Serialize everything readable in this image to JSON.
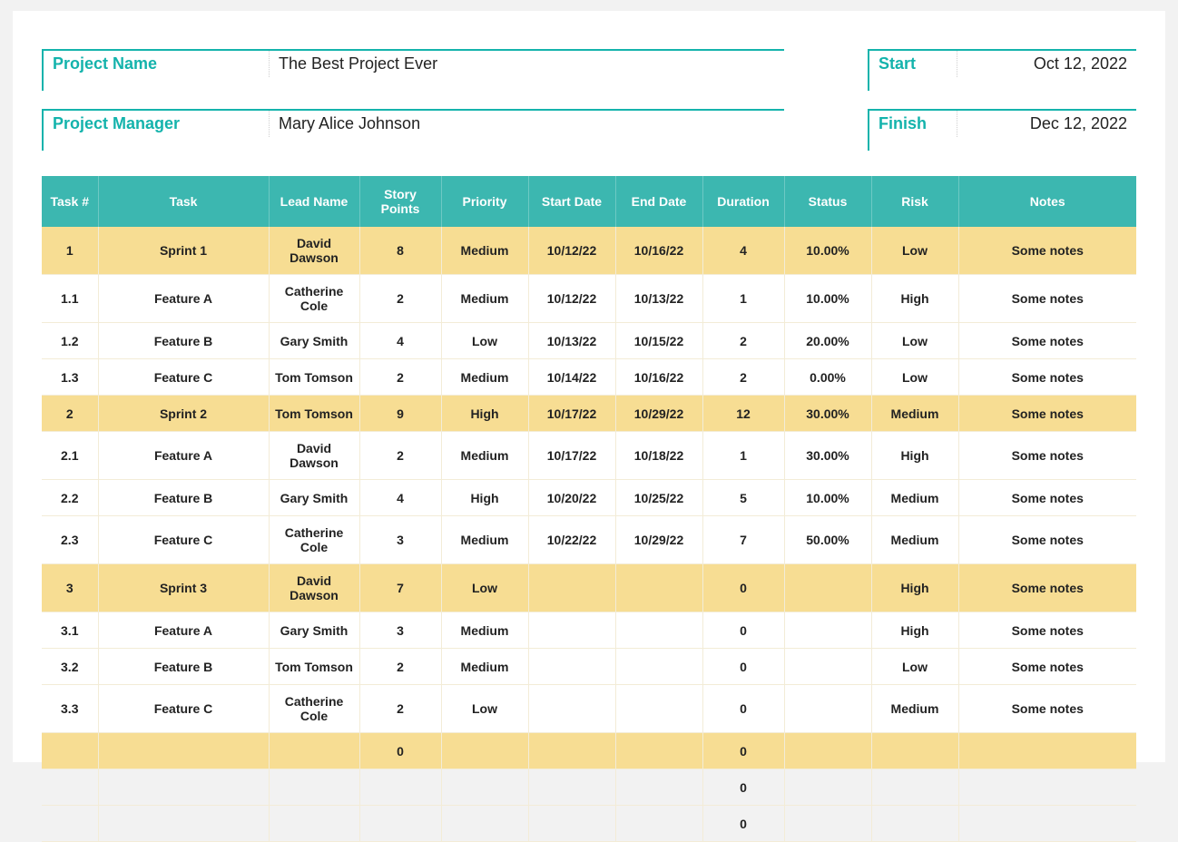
{
  "meta": {
    "project_name_label": "Project Name",
    "project_name_value": "The Best Project Ever",
    "project_manager_label": "Project Manager",
    "project_manager_value": "Mary Alice Johnson",
    "start_label": "Start",
    "start_value": "Oct 12, 2022",
    "finish_label": "Finish",
    "finish_value": "Dec 12, 2022"
  },
  "columns": {
    "tasknum": "Task #",
    "task": "Task",
    "lead": "Lead Name",
    "points": "Story Points",
    "priority": "Priority",
    "start": "Start Date",
    "end": "End Date",
    "duration": "Duration",
    "status": "Status",
    "risk": "Risk",
    "notes": "Notes"
  },
  "rows": [
    {
      "type": "sprint",
      "tasknum": "1",
      "task": "Sprint 1",
      "lead": "David Dawson",
      "points": "8",
      "priority": "Medium",
      "start": "10/12/22",
      "end": "10/16/22",
      "duration": "4",
      "status": "10.00%",
      "risk": "Low",
      "notes": "Some notes"
    },
    {
      "type": "task",
      "tasknum": "1.1",
      "task": "Feature A",
      "lead": "Catherine Cole",
      "points": "2",
      "priority": "Medium",
      "start": "10/12/22",
      "end": "10/13/22",
      "duration": "1",
      "status": "10.00%",
      "risk": "High",
      "notes": "Some notes"
    },
    {
      "type": "task",
      "tasknum": "1.2",
      "task": "Feature B",
      "lead": "Gary Smith",
      "points": "4",
      "priority": "Low",
      "start": "10/13/22",
      "end": "10/15/22",
      "duration": "2",
      "status": "20.00%",
      "risk": "Low",
      "notes": "Some notes"
    },
    {
      "type": "task",
      "tasknum": "1.3",
      "task": "Feature C",
      "lead": "Tom Tomson",
      "points": "2",
      "priority": "Medium",
      "start": "10/14/22",
      "end": "10/16/22",
      "duration": "2",
      "status": "0.00%",
      "risk": "Low",
      "notes": "Some notes"
    },
    {
      "type": "sprint",
      "tasknum": "2",
      "task": "Sprint 2",
      "lead": "Tom Tomson",
      "points": "9",
      "priority": "High",
      "start": "10/17/22",
      "end": "10/29/22",
      "duration": "12",
      "status": "30.00%",
      "risk": "Medium",
      "notes": "Some notes"
    },
    {
      "type": "task",
      "tasknum": "2.1",
      "task": "Feature A",
      "lead": "David Dawson",
      "points": "2",
      "priority": "Medium",
      "start": "10/17/22",
      "end": "10/18/22",
      "duration": "1",
      "status": "30.00%",
      "risk": "High",
      "notes": "Some notes"
    },
    {
      "type": "task",
      "tasknum": "2.2",
      "task": "Feature B",
      "lead": "Gary Smith",
      "points": "4",
      "priority": "High",
      "start": "10/20/22",
      "end": "10/25/22",
      "duration": "5",
      "status": "10.00%",
      "risk": "Medium",
      "notes": "Some notes"
    },
    {
      "type": "task",
      "tasknum": "2.3",
      "task": "Feature C",
      "lead": "Catherine Cole",
      "points": "3",
      "priority": "Medium",
      "start": "10/22/22",
      "end": "10/29/22",
      "duration": "7",
      "status": "50.00%",
      "risk": "Medium",
      "notes": "Some notes"
    },
    {
      "type": "sprint",
      "tasknum": "3",
      "task": "Sprint 3",
      "lead": "David Dawson",
      "points": "7",
      "priority": "Low",
      "start": "",
      "end": "",
      "duration": "0",
      "status": "",
      "risk": "High",
      "notes": "Some notes"
    },
    {
      "type": "task",
      "tasknum": "3.1",
      "task": "Feature A",
      "lead": "Gary Smith",
      "points": "3",
      "priority": "Medium",
      "start": "",
      "end": "",
      "duration": "0",
      "status": "",
      "risk": "High",
      "notes": "Some notes"
    },
    {
      "type": "task",
      "tasknum": "3.2",
      "task": "Feature B",
      "lead": "Tom Tomson",
      "points": "2",
      "priority": "Medium",
      "start": "",
      "end": "",
      "duration": "0",
      "status": "",
      "risk": "Low",
      "notes": "Some notes"
    },
    {
      "type": "task",
      "tasknum": "3.3",
      "task": "Feature C",
      "lead": "Catherine Cole",
      "points": "2",
      "priority": "Low",
      "start": "",
      "end": "",
      "duration": "0",
      "status": "",
      "risk": "Medium",
      "notes": "Some notes"
    },
    {
      "type": "blank-yellow",
      "tasknum": "",
      "task": "",
      "lead": "",
      "points": "0",
      "priority": "",
      "start": "",
      "end": "",
      "duration": "0",
      "status": "",
      "risk": "",
      "notes": ""
    },
    {
      "type": "blank",
      "tasknum": "",
      "task": "",
      "lead": "",
      "points": "",
      "priority": "",
      "start": "",
      "end": "",
      "duration": "0",
      "status": "",
      "risk": "",
      "notes": ""
    },
    {
      "type": "blank",
      "tasknum": "",
      "task": "",
      "lead": "",
      "points": "",
      "priority": "",
      "start": "",
      "end": "",
      "duration": "0",
      "status": "",
      "risk": "",
      "notes": ""
    }
  ]
}
